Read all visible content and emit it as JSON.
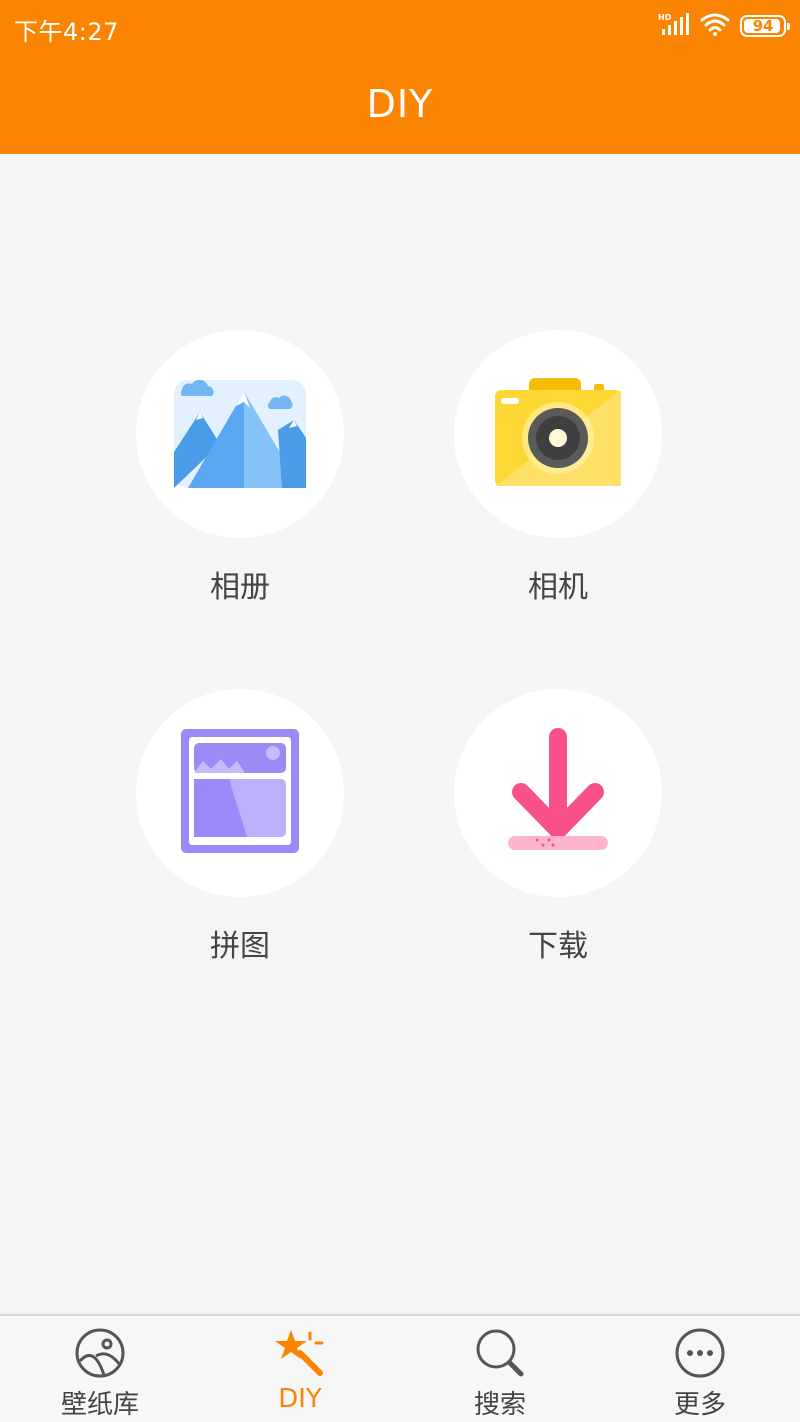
{
  "status_bar": {
    "time": "下午4:27",
    "battery": "94",
    "icons": [
      "hd-signal-icon",
      "wifi-icon",
      "battery-icon"
    ]
  },
  "app_bar": {
    "title": "DIY"
  },
  "tiles": [
    {
      "label": "相册",
      "icon": "photo-album-icon"
    },
    {
      "label": "相机",
      "icon": "camera-icon"
    },
    {
      "label": "拼图",
      "icon": "collage-icon"
    },
    {
      "label": "下载",
      "icon": "download-icon"
    }
  ],
  "tab_bar": {
    "active_index": 1,
    "tabs": [
      {
        "label": "壁纸库",
        "icon": "wallpaper-library-icon"
      },
      {
        "label": "DIY",
        "icon": "magic-wand-icon"
      },
      {
        "label": "搜索",
        "icon": "search-icon"
      },
      {
        "label": "更多",
        "icon": "more-icon"
      }
    ]
  },
  "colors": {
    "accent": "#fb8402",
    "background": "#f5f5f5",
    "tile_background": "#ffffff",
    "text": "#444444"
  }
}
